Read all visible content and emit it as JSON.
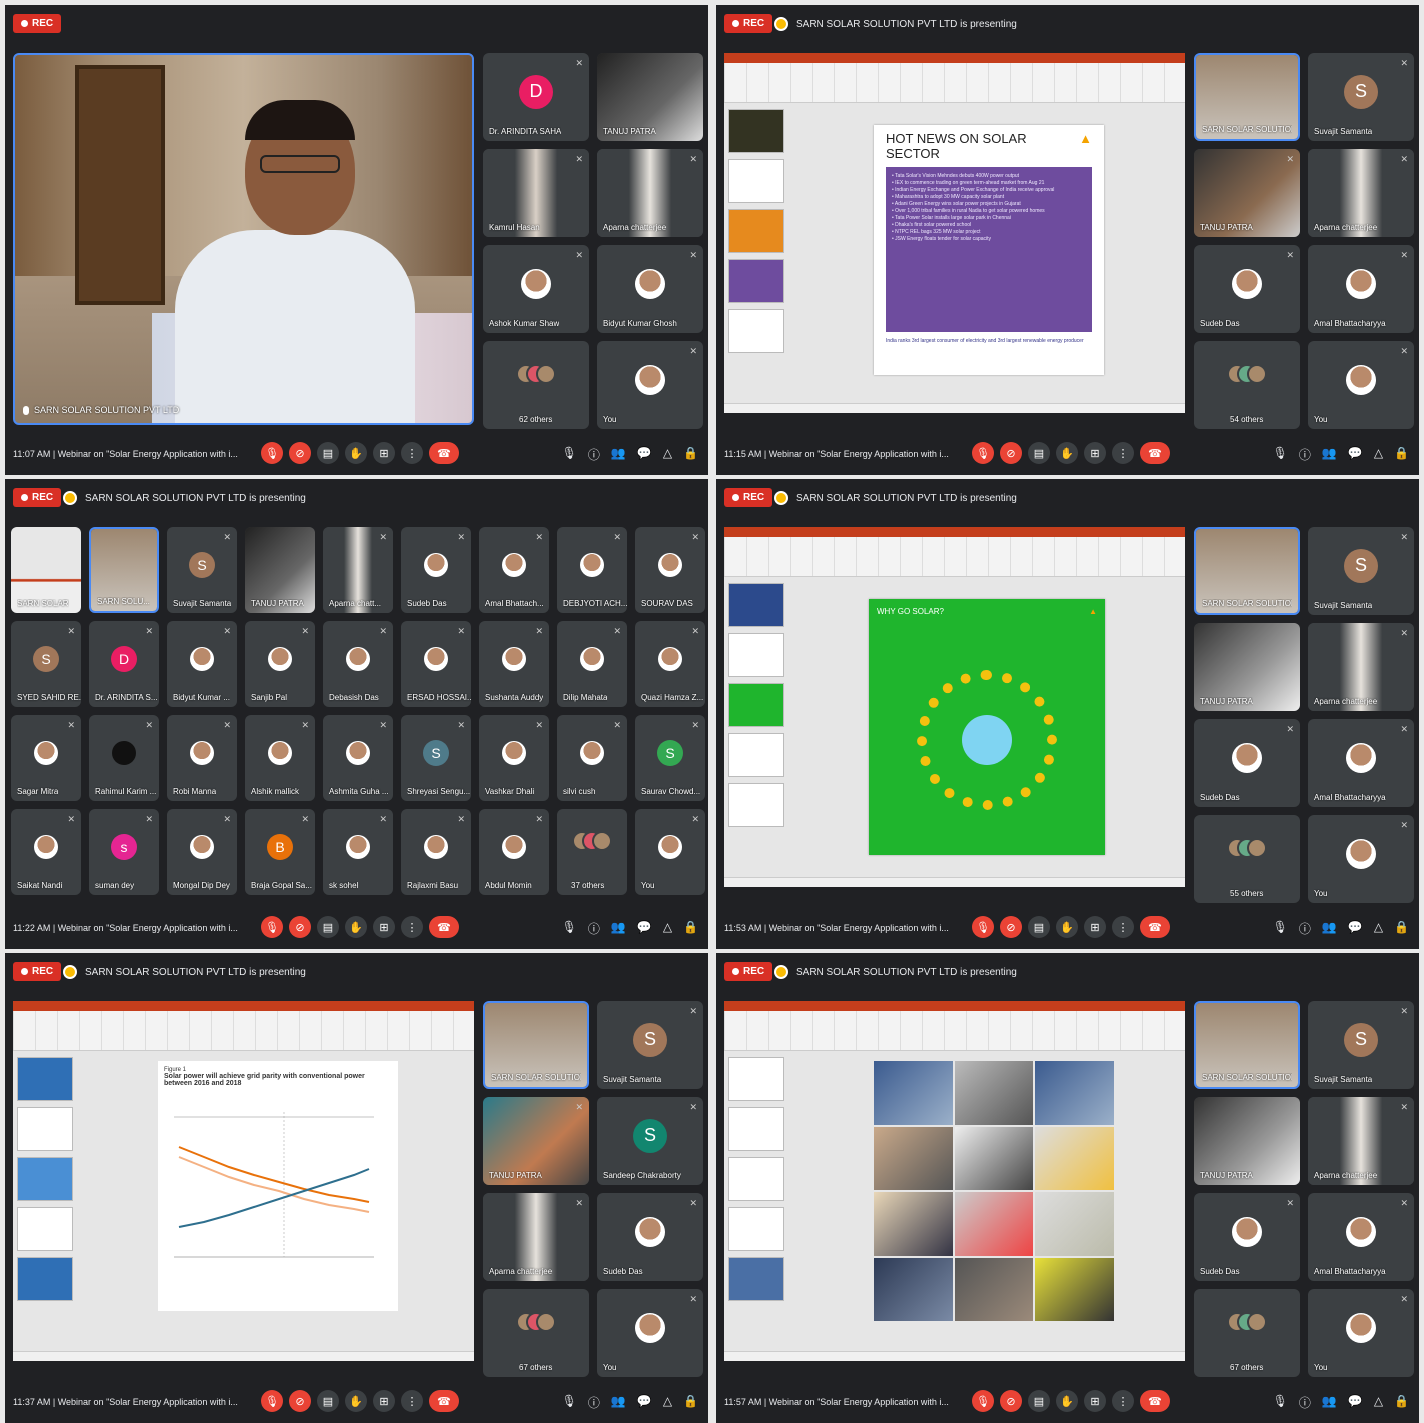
{
  "common": {
    "rec_label": "REC",
    "presenting": "SARN SOLAR SOLUTION PVT LTD is presenting",
    "meeting_title": "Webinar on \"Solar Energy Application with i..."
  },
  "panels": [
    {
      "time": "11:07 AM",
      "main_name": "SARN SOLAR SOLUTION PVT LTD",
      "tiles": [
        "Dr. ARINDITA SAHA",
        "TANUJ PATRA",
        "Kamrul Hasan",
        "Aparna chatterjee",
        "Ashok Kumar Shaw",
        "Bidyut Kumar Ghosh",
        "62 others",
        "You"
      ]
    },
    {
      "time": "11:15 AM",
      "slide_title": "HOT NEWS ON SOLAR SECTOR",
      "tiles": [
        "SARN SOLAR SOLUTION",
        "Suvajit Samanta",
        "TANUJ PATRA",
        "Aparna chatterjee",
        "Sudeb Das",
        "Amal Bhattacharyya",
        "54 others",
        "You"
      ]
    },
    {
      "time": "11:22 AM",
      "tiles": [
        "SARN SOLAR",
        "SARN SOLU...",
        "Suvajit Samanta",
        "TANUJ PATRA",
        "Aparna chatt...",
        "Sudeb Das",
        "Amal Bhattach...",
        "DEBJYOTI ACH...",
        "SOURAV DAS",
        "SYED SAHID RE...",
        "Dr. ARINDITA S...",
        "Bidyut Kumar ...",
        "Sanjib Pal",
        "Debasish Das",
        "ERSAD HOSSAI...",
        "Sushanta Auddy",
        "Dilip Mahata",
        "Quazi Hamza Z...",
        "Sagar Mitra",
        "Rahimul Karim ...",
        "Robi Manna",
        "Alshik mallick",
        "Ashmita Guha ...",
        "Shreyasi Sengu...",
        "Vashkar Dhali",
        "silvi cush",
        "Saurav Chowd...",
        "Saikat Nandi",
        "suman dey",
        "Mongal Dip Dey",
        "Braja Gopal Sa...",
        "sk sohel",
        "Rajlaxmi Basu",
        "Abdul Momin",
        "37 others",
        "You"
      ]
    },
    {
      "time": "11:53 AM",
      "slide_title": "WHY GO SOLAR?",
      "tiles": [
        "SARN SOLAR SOLUTION",
        "Suvajit Samanta",
        "TANUJ PATRA",
        "Aparna chatterjee",
        "Sudeb Das",
        "Amal Bhattacharyya",
        "55 others",
        "You"
      ]
    },
    {
      "time": "11:37 AM",
      "slide_title": "Figure 1",
      "slide_subtitle": "Solar power will achieve grid parity with conventional power between 2016 and 2018",
      "tiles": [
        "SARN SOLAR SOLUTION",
        "Suvajit Samanta",
        "TANUJ PATRA",
        "Sandeep Chakraborty",
        "Aparna chatterjee",
        "Sudeb Das",
        "67 others",
        "You"
      ]
    },
    {
      "time": "11:57 AM",
      "tiles": [
        "SARN SOLAR SOLUTION",
        "Suvajit Samanta",
        "TANUJ PATRA",
        "Aparna chatterjee",
        "Sudeb Das",
        "Amal Bhattacharyya",
        "67 others",
        "You"
      ]
    }
  ]
}
